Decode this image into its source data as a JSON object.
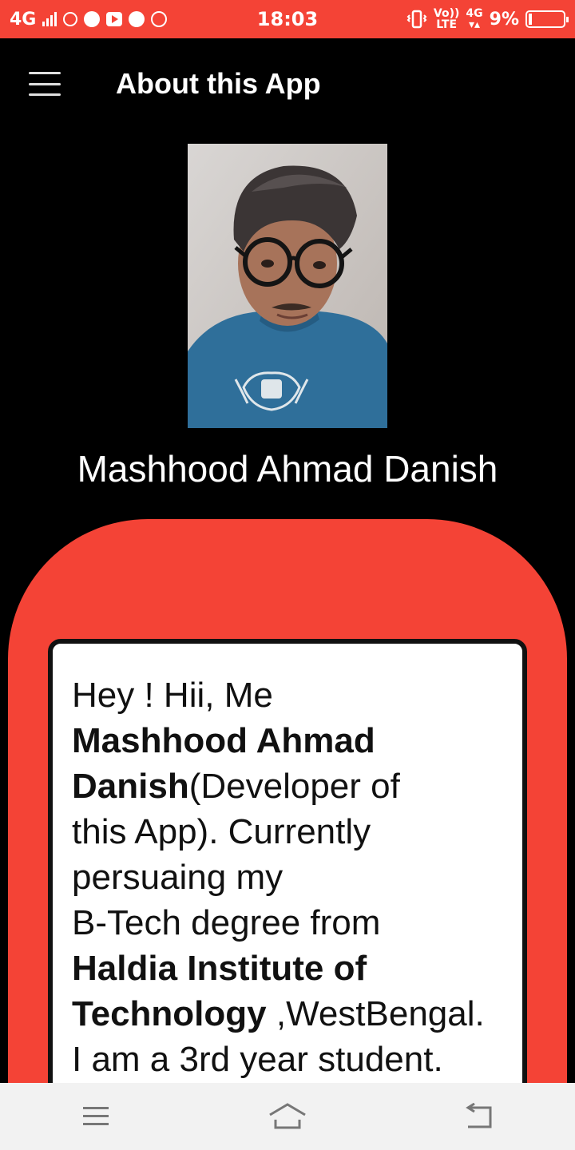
{
  "status_bar": {
    "network": "4G",
    "time": "18:03",
    "volte_top": "Vo))",
    "volte_bottom": "LTE",
    "net2": "4G",
    "battery": "9%",
    "battery_level": 0.09
  },
  "app_bar": {
    "title": "About this App"
  },
  "profile": {
    "name": "Mashhood Ahmad Danish"
  },
  "about": {
    "line1": "Hey ! Hii, Me",
    "name_bold_1": "Mashhood Ahmad",
    "name_bold_2": "Danish",
    "after_name": "(Developer of",
    "line3": "this App). Currently",
    "line4": "persuaing my",
    "line5": "B-Tech degree from",
    "inst_bold_1": "Haldia Institute of",
    "inst_bold_2": "Technology",
    "after_inst": " ,WestBengal.",
    "line8": "I am a 3rd year student."
  },
  "colors": {
    "accent": "#f44336",
    "background": "#000000",
    "card": "#ffffff"
  },
  "icons": {
    "menu": "hamburger-icon",
    "nav_recent": "recent-apps-icon",
    "nav_home": "home-icon",
    "nav_back": "back-icon"
  }
}
